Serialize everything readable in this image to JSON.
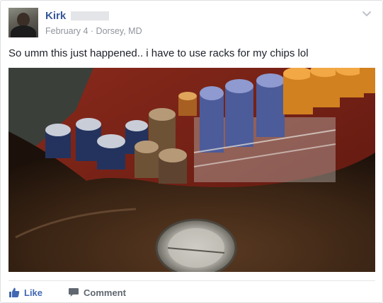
{
  "post": {
    "author": "Kirk",
    "meta": "February 4 · Dorsey, MD",
    "text": "So umm this just happened.. i have to use racks for my chips lol"
  },
  "actions": {
    "like_label": "Like",
    "comment_label": "Comment"
  },
  "colors": {
    "link_blue": "#365899",
    "action_blue": "#4267b2",
    "meta_gray": "#90949c",
    "text_dark": "#1d2129"
  },
  "icons": {
    "menu": "chevron-down-icon",
    "like": "thumbs-up-icon",
    "comment": "speech-bubble-icon"
  }
}
